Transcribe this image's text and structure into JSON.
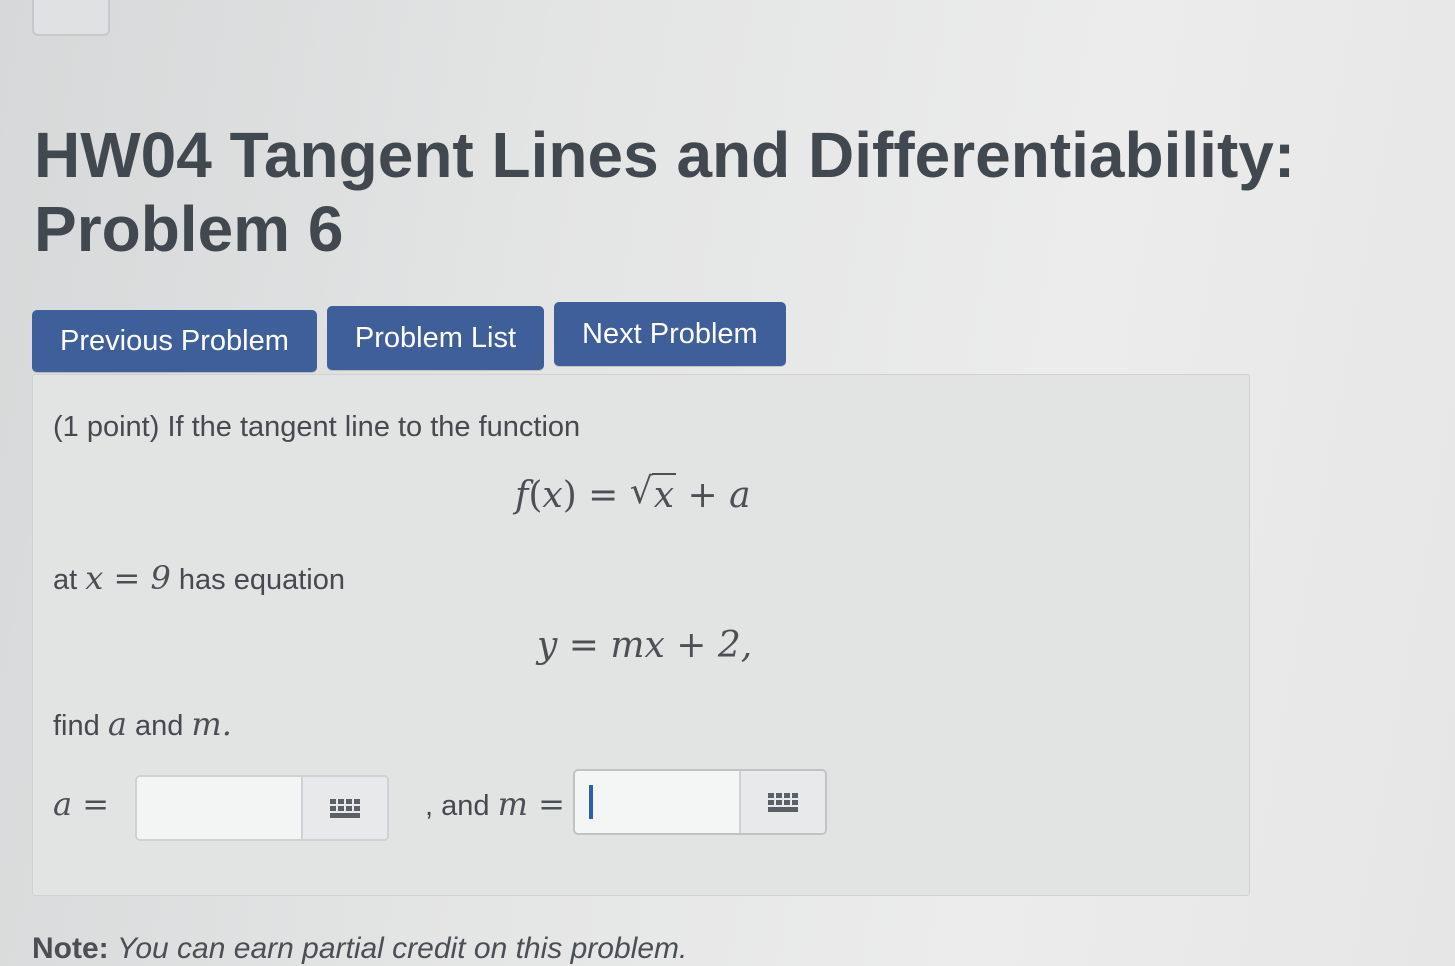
{
  "header": {
    "title_line1": "HW04 Tangent Lines and Differentiability:",
    "title_line2": "Problem 6"
  },
  "nav": {
    "previous_label": "Previous Problem",
    "list_label": "Problem List",
    "next_label": "Next Problem"
  },
  "problem": {
    "intro": "(1 point) If the tangent line to the function",
    "equation_function": "f(x) = √x + a",
    "at_prefix": "at",
    "at_condition": "x = 9",
    "at_suffix": "has equation",
    "equation_tangent": "y = mx + 2,",
    "find_prefix": "find",
    "find_var_a": "a",
    "find_and": "and",
    "find_var_m": "m",
    "find_period": "."
  },
  "answers": {
    "a_label": "a =",
    "a_value": "",
    "m_joiner": ", and",
    "m_label": "m =",
    "m_value": "",
    "keyboard_icon": "math-keyboard-icon"
  },
  "note": {
    "label": "Note:",
    "text": "You can earn partial credit on this problem."
  },
  "colors": {
    "button_bg": "#3f5f9a",
    "caret": "#2f5fa6"
  }
}
